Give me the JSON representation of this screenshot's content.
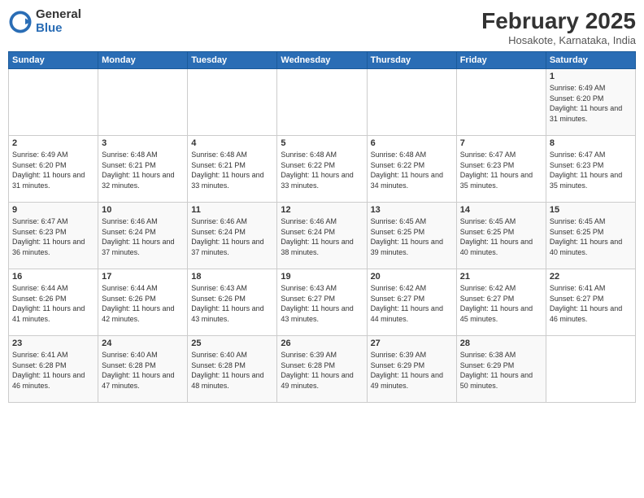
{
  "logo": {
    "general": "General",
    "blue": "Blue"
  },
  "title": "February 2025",
  "subtitle": "Hosakote, Karnataka, India",
  "days_of_week": [
    "Sunday",
    "Monday",
    "Tuesday",
    "Wednesday",
    "Thursday",
    "Friday",
    "Saturday"
  ],
  "weeks": [
    [
      {
        "day": "",
        "info": ""
      },
      {
        "day": "",
        "info": ""
      },
      {
        "day": "",
        "info": ""
      },
      {
        "day": "",
        "info": ""
      },
      {
        "day": "",
        "info": ""
      },
      {
        "day": "",
        "info": ""
      },
      {
        "day": "1",
        "info": "Sunrise: 6:49 AM\nSunset: 6:20 PM\nDaylight: 11 hours and 31 minutes."
      }
    ],
    [
      {
        "day": "2",
        "info": "Sunrise: 6:49 AM\nSunset: 6:20 PM\nDaylight: 11 hours and 31 minutes."
      },
      {
        "day": "3",
        "info": "Sunrise: 6:48 AM\nSunset: 6:21 PM\nDaylight: 11 hours and 32 minutes."
      },
      {
        "day": "4",
        "info": "Sunrise: 6:48 AM\nSunset: 6:21 PM\nDaylight: 11 hours and 33 minutes."
      },
      {
        "day": "5",
        "info": "Sunrise: 6:48 AM\nSunset: 6:22 PM\nDaylight: 11 hours and 33 minutes."
      },
      {
        "day": "6",
        "info": "Sunrise: 6:48 AM\nSunset: 6:22 PM\nDaylight: 11 hours and 34 minutes."
      },
      {
        "day": "7",
        "info": "Sunrise: 6:47 AM\nSunset: 6:23 PM\nDaylight: 11 hours and 35 minutes."
      },
      {
        "day": "8",
        "info": "Sunrise: 6:47 AM\nSunset: 6:23 PM\nDaylight: 11 hours and 35 minutes."
      }
    ],
    [
      {
        "day": "9",
        "info": "Sunrise: 6:47 AM\nSunset: 6:23 PM\nDaylight: 11 hours and 36 minutes."
      },
      {
        "day": "10",
        "info": "Sunrise: 6:46 AM\nSunset: 6:24 PM\nDaylight: 11 hours and 37 minutes."
      },
      {
        "day": "11",
        "info": "Sunrise: 6:46 AM\nSunset: 6:24 PM\nDaylight: 11 hours and 37 minutes."
      },
      {
        "day": "12",
        "info": "Sunrise: 6:46 AM\nSunset: 6:24 PM\nDaylight: 11 hours and 38 minutes."
      },
      {
        "day": "13",
        "info": "Sunrise: 6:45 AM\nSunset: 6:25 PM\nDaylight: 11 hours and 39 minutes."
      },
      {
        "day": "14",
        "info": "Sunrise: 6:45 AM\nSunset: 6:25 PM\nDaylight: 11 hours and 40 minutes."
      },
      {
        "day": "15",
        "info": "Sunrise: 6:45 AM\nSunset: 6:25 PM\nDaylight: 11 hours and 40 minutes."
      }
    ],
    [
      {
        "day": "16",
        "info": "Sunrise: 6:44 AM\nSunset: 6:26 PM\nDaylight: 11 hours and 41 minutes."
      },
      {
        "day": "17",
        "info": "Sunrise: 6:44 AM\nSunset: 6:26 PM\nDaylight: 11 hours and 42 minutes."
      },
      {
        "day": "18",
        "info": "Sunrise: 6:43 AM\nSunset: 6:26 PM\nDaylight: 11 hours and 43 minutes."
      },
      {
        "day": "19",
        "info": "Sunrise: 6:43 AM\nSunset: 6:27 PM\nDaylight: 11 hours and 43 minutes."
      },
      {
        "day": "20",
        "info": "Sunrise: 6:42 AM\nSunset: 6:27 PM\nDaylight: 11 hours and 44 minutes."
      },
      {
        "day": "21",
        "info": "Sunrise: 6:42 AM\nSunset: 6:27 PM\nDaylight: 11 hours and 45 minutes."
      },
      {
        "day": "22",
        "info": "Sunrise: 6:41 AM\nSunset: 6:27 PM\nDaylight: 11 hours and 46 minutes."
      }
    ],
    [
      {
        "day": "23",
        "info": "Sunrise: 6:41 AM\nSunset: 6:28 PM\nDaylight: 11 hours and 46 minutes."
      },
      {
        "day": "24",
        "info": "Sunrise: 6:40 AM\nSunset: 6:28 PM\nDaylight: 11 hours and 47 minutes."
      },
      {
        "day": "25",
        "info": "Sunrise: 6:40 AM\nSunset: 6:28 PM\nDaylight: 11 hours and 48 minutes."
      },
      {
        "day": "26",
        "info": "Sunrise: 6:39 AM\nSunset: 6:28 PM\nDaylight: 11 hours and 49 minutes."
      },
      {
        "day": "27",
        "info": "Sunrise: 6:39 AM\nSunset: 6:29 PM\nDaylight: 11 hours and 49 minutes."
      },
      {
        "day": "28",
        "info": "Sunrise: 6:38 AM\nSunset: 6:29 PM\nDaylight: 11 hours and 50 minutes."
      },
      {
        "day": "",
        "info": ""
      }
    ]
  ]
}
